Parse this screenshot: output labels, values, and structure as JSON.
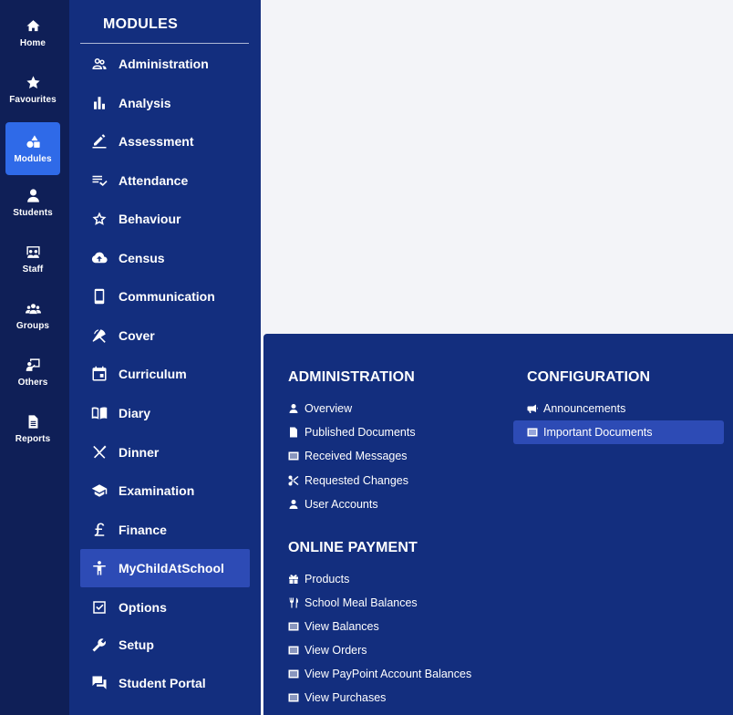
{
  "rail": {
    "items": [
      {
        "label": "Home",
        "icon": "home-icon"
      },
      {
        "label": "Favourites",
        "icon": "star-icon"
      },
      {
        "label": "Modules",
        "icon": "shapes-icon"
      },
      {
        "label": "Students",
        "icon": "user-icon"
      },
      {
        "label": "Staff",
        "icon": "presentation-icon"
      },
      {
        "label": "Groups",
        "icon": "group-icon"
      },
      {
        "label": "Others",
        "icon": "chalkboard-user-icon"
      },
      {
        "label": "Reports",
        "icon": "document-icon"
      }
    ],
    "active": "Modules"
  },
  "modules": {
    "title": "MODULES",
    "items": [
      {
        "label": "Administration",
        "icon": "people-icon"
      },
      {
        "label": "Analysis",
        "icon": "bar-chart-icon"
      },
      {
        "label": "Assessment",
        "icon": "pen-icon"
      },
      {
        "label": "Attendance",
        "icon": "list-check-icon"
      },
      {
        "label": "Behaviour",
        "icon": "star-outline-icon"
      },
      {
        "label": "Census",
        "icon": "cloud-upload-icon"
      },
      {
        "label": "Communication",
        "icon": "phone-icon"
      },
      {
        "label": "Cover",
        "icon": "umbrella-icon"
      },
      {
        "label": "Curriculum",
        "icon": "calendar-icon"
      },
      {
        "label": "Diary",
        "icon": "book-icon"
      },
      {
        "label": "Dinner",
        "icon": "cutlery-icon"
      },
      {
        "label": "Examination",
        "icon": "graduation-cap-icon"
      },
      {
        "label": "Finance",
        "icon": "pound-icon"
      },
      {
        "label": "MyChildAtSchool",
        "icon": "child-icon"
      },
      {
        "label": "Options",
        "icon": "checkbox-icon"
      },
      {
        "label": "Setup",
        "icon": "wrench-icon"
      },
      {
        "label": "Student Portal",
        "icon": "chat-icon"
      }
    ],
    "active": "MyChildAtSchool"
  },
  "panel": {
    "administration": {
      "title": "ADMINISTRATION",
      "links": [
        {
          "label": "Overview",
          "icon": "user-icon"
        },
        {
          "label": "Published Documents",
          "icon": "file-icon"
        },
        {
          "label": "Received Messages",
          "icon": "list-icon"
        },
        {
          "label": "Requested Changes",
          "icon": "scissors-icon"
        },
        {
          "label": "User Accounts",
          "icon": "user-icon"
        }
      ]
    },
    "online_payment": {
      "title": "ONLINE PAYMENT",
      "links": [
        {
          "label": "Products",
          "icon": "gift-icon"
        },
        {
          "label": "School Meal Balances",
          "icon": "cutlery-icon"
        },
        {
          "label": "View Balances",
          "icon": "list-icon"
        },
        {
          "label": "View Orders",
          "icon": "list-icon"
        },
        {
          "label": "View PayPoint Account Balances",
          "icon": "list-icon"
        },
        {
          "label": "View Purchases",
          "icon": "list-icon"
        }
      ]
    },
    "configuration": {
      "title": "CONFIGURATION",
      "links": [
        {
          "label": "Announcements",
          "icon": "megaphone-icon"
        },
        {
          "label": "Important Documents",
          "icon": "list-icon"
        }
      ],
      "active": "Important Documents"
    }
  }
}
